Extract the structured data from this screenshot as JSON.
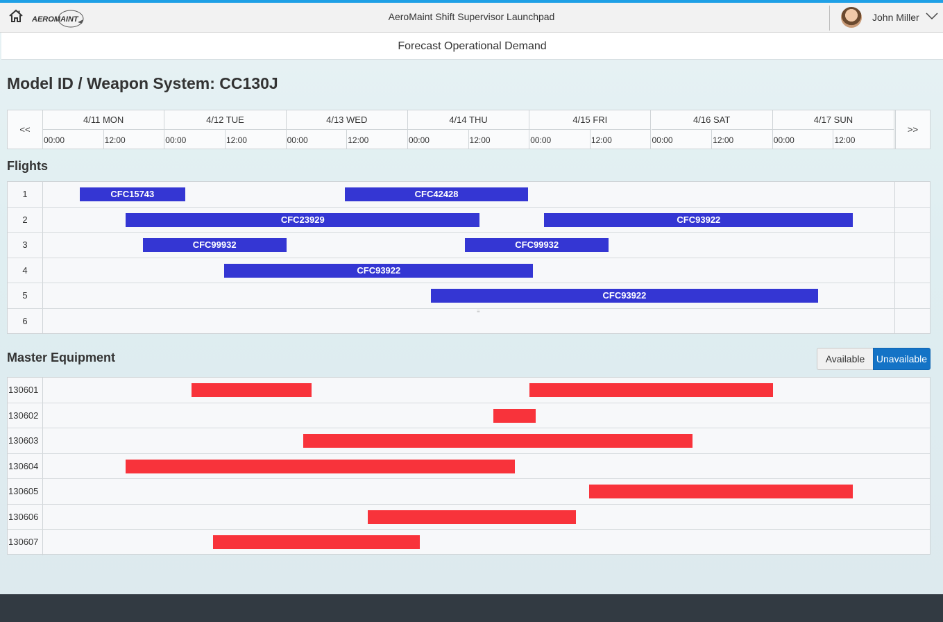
{
  "shell": {
    "title": "AeroMaint Shift Supervisor Launchpad",
    "logo_text": "AEROMAINT",
    "user_name": "John Miller",
    "home_icon": "home-icon",
    "chevron_icon": "chevron-down-icon"
  },
  "subheader": {
    "title": "Forecast Operational Demand"
  },
  "page": {
    "title": "Model ID / Weapon System: CC130J"
  },
  "timeline": {
    "prev_label": "<<",
    "next_label": ">>",
    "days": [
      {
        "label": "4/11 MON",
        "hours": [
          "00:00",
          "12:00"
        ]
      },
      {
        "label": "4/12 TUE",
        "hours": [
          "00:00",
          "12:00"
        ]
      },
      {
        "label": "4/13 WED",
        "hours": [
          "00:00",
          "12:00"
        ]
      },
      {
        "label": "4/14 THU",
        "hours": [
          "00:00",
          "12:00"
        ]
      },
      {
        "label": "4/15 FRI",
        "hours": [
          "00:00",
          "12:00"
        ]
      },
      {
        "label": "4/16 SAT",
        "hours": [
          "00:00",
          "12:00"
        ]
      },
      {
        "label": "4/17 SUN",
        "hours": [
          "00:00",
          "12:00"
        ]
      }
    ]
  },
  "flights": {
    "title": "Flights",
    "bar_color": "#3436d3",
    "rows": [
      {
        "label": "1",
        "bars": [
          {
            "id": "CFC15743",
            "start": 0.3,
            "end": 1.17
          },
          {
            "id": "CFC42428",
            "start": 2.48,
            "end": 3.99
          }
        ]
      },
      {
        "label": "2",
        "bars": [
          {
            "id": "CFC23929",
            "start": 0.68,
            "end": 3.59
          },
          {
            "id": "CFC93922",
            "start": 4.12,
            "end": 6.66
          }
        ]
      },
      {
        "label": "3",
        "bars": [
          {
            "id": "CFC99932",
            "start": 0.82,
            "end": 2.0
          },
          {
            "id": "CFC99932",
            "start": 3.47,
            "end": 4.65
          }
        ]
      },
      {
        "label": "4",
        "bars": [
          {
            "id": "CFC93922",
            "start": 1.49,
            "end": 4.03
          }
        ]
      },
      {
        "label": "5",
        "bars": [
          {
            "id": "CFC93922",
            "start": 3.19,
            "end": 6.37
          }
        ]
      },
      {
        "label": "6",
        "bars": []
      }
    ]
  },
  "equipment": {
    "title": "Master Equipment",
    "bar_color": "#f8333b",
    "toggle": {
      "available_label": "Available",
      "unavailable_label": "Unavailable",
      "selected": "Unavailable"
    },
    "rows": [
      {
        "label": "130601",
        "bars": [
          {
            "start": 1.22,
            "end": 2.21
          },
          {
            "start": 4.0,
            "end": 6.0
          }
        ]
      },
      {
        "label": "130602",
        "bars": [
          {
            "start": 3.7,
            "end": 4.05
          }
        ]
      },
      {
        "label": "130603",
        "bars": [
          {
            "start": 2.14,
            "end": 5.34
          }
        ]
      },
      {
        "label": "130604",
        "bars": [
          {
            "start": 0.68,
            "end": 3.88
          }
        ]
      },
      {
        "label": "130605",
        "bars": [
          {
            "start": 4.49,
            "end": 6.66
          }
        ]
      },
      {
        "label": "130606",
        "bars": [
          {
            "start": 2.67,
            "end": 4.38
          }
        ]
      },
      {
        "label": "130607",
        "bars": [
          {
            "start": 1.4,
            "end": 3.1
          }
        ]
      }
    ]
  }
}
